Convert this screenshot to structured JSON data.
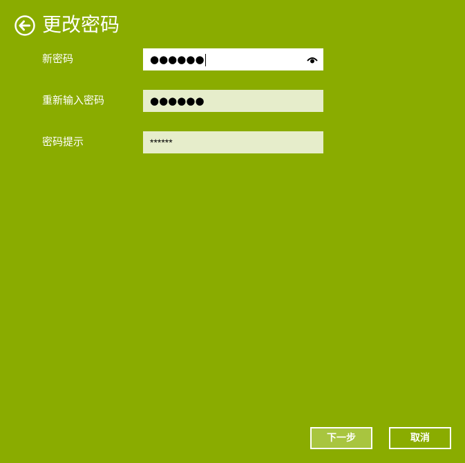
{
  "header": {
    "title": "更改密码",
    "back_icon": "back-arrow-circle-icon"
  },
  "form": {
    "new_password": {
      "label": "新密码",
      "value": "●●●●●●",
      "reveal_icon": "eye-icon"
    },
    "confirm_password": {
      "label": "重新输入密码",
      "value": "●●●●●●"
    },
    "password_hint": {
      "label": "密码提示",
      "value": "******"
    }
  },
  "footer": {
    "next_label": "下一步",
    "cancel_label": "取消"
  },
  "colors": {
    "background": "#8aac00",
    "field_bg": "#e6edcb",
    "field_active_bg": "#ffffff",
    "primary_button_bg": "#a8c53f"
  }
}
